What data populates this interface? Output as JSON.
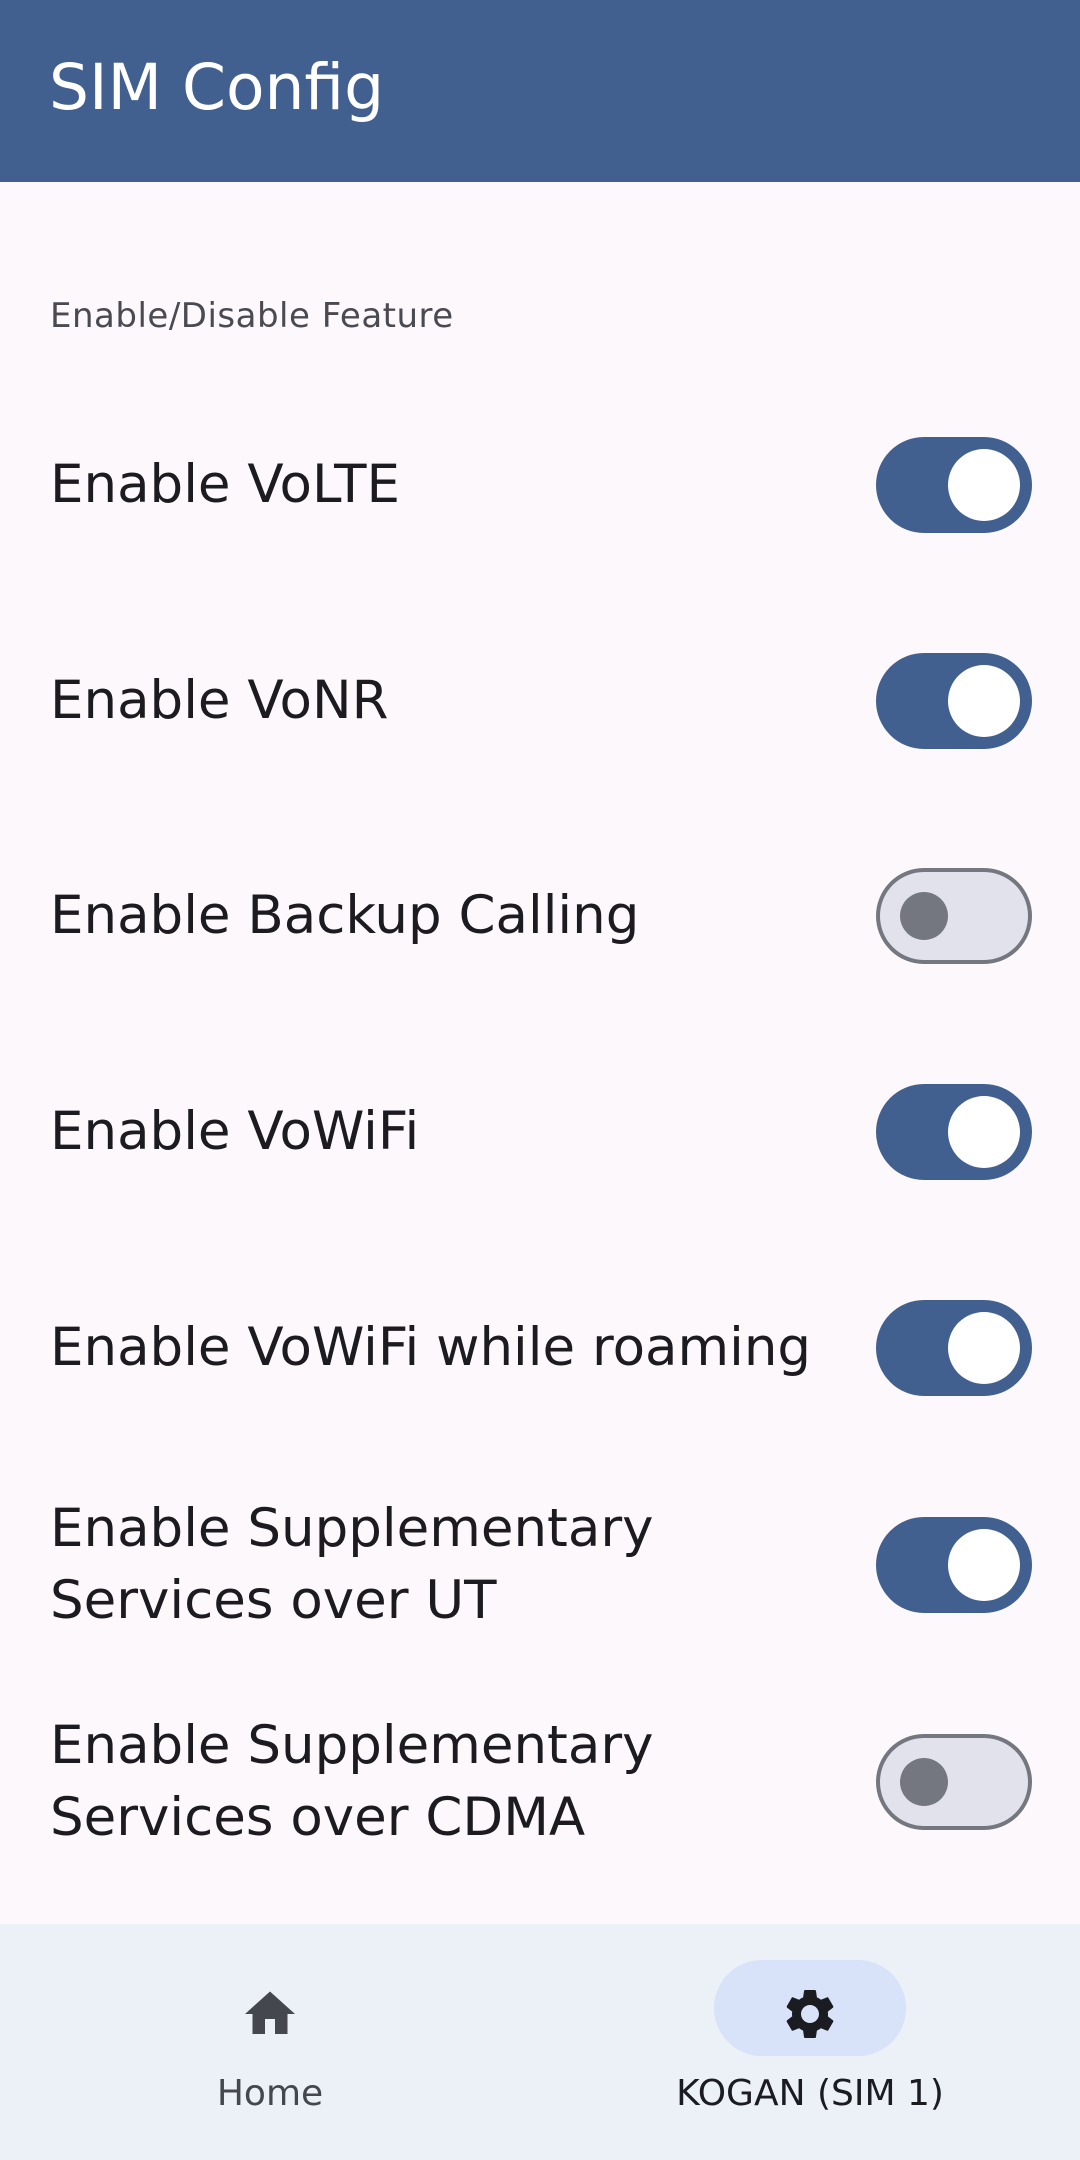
{
  "app_bar": {
    "title": "SIM Config",
    "background": "#42608f"
  },
  "section": {
    "header": "Enable/Disable Feature"
  },
  "settings": [
    {
      "label": "Enable VoLTE",
      "enabled": true
    },
    {
      "label": "Enable VoNR",
      "enabled": true
    },
    {
      "label": "Enable Backup Calling",
      "enabled": false
    },
    {
      "label": "Enable VoWiFi",
      "enabled": true
    },
    {
      "label": "Enable VoWiFi while roaming",
      "enabled": true
    },
    {
      "label": "Enable Supplementary\nServices over UT",
      "enabled": true
    },
    {
      "label": "Enable Supplementary\nServices over CDMA",
      "enabled": false
    }
  ],
  "bottom_nav": {
    "items": [
      {
        "label": "Home",
        "icon": "home-icon",
        "active": false
      },
      {
        "label": "KOGAN (SIM 1)",
        "icon": "gear-icon",
        "active": true
      }
    ]
  },
  "colors": {
    "accent": "#42608f",
    "switch_off_track": "#e1e2eb",
    "switch_off_outline": "#74777f",
    "nav_background": "#ecf0f7",
    "nav_active_indicator": "#d8e2f8"
  }
}
